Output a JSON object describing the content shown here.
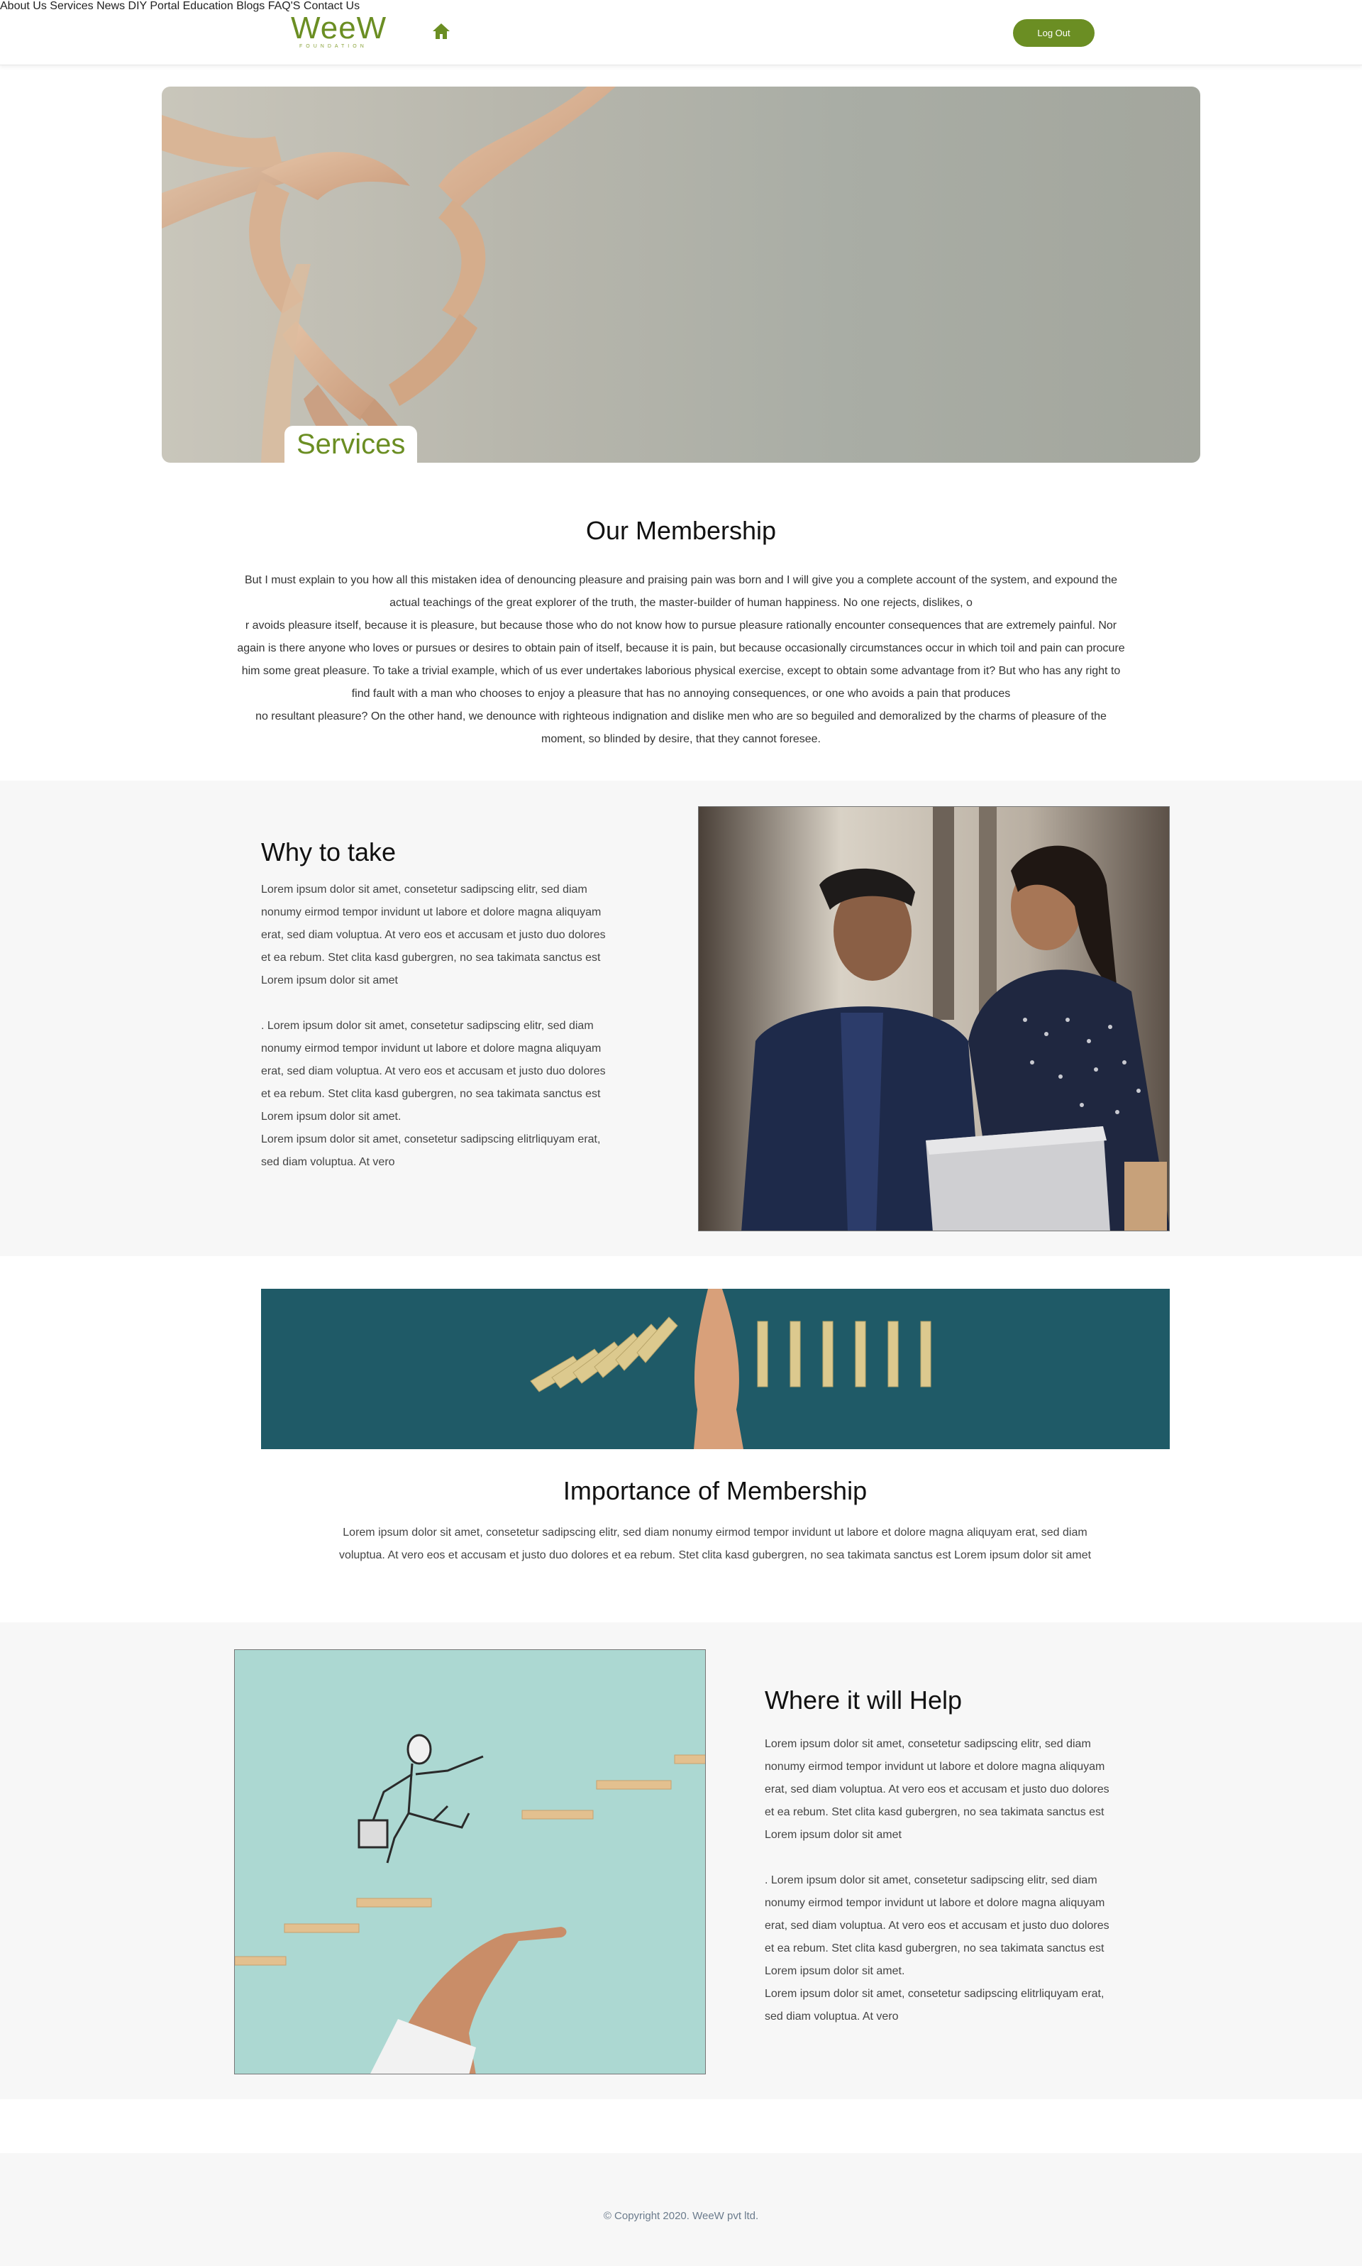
{
  "brand": {
    "name": "WeeW",
    "tagline": "FOUNDATION",
    "accent_color": "#6b8e23"
  },
  "nav": {
    "home_icon": "home-icon",
    "items": [
      {
        "label": "About Us"
      },
      {
        "label": "Services"
      },
      {
        "label": "News"
      },
      {
        "label": "DIY Portal"
      },
      {
        "label": "Education"
      },
      {
        "label": "Blogs"
      },
      {
        "label": "FAQ'S"
      },
      {
        "label": "Contact Us"
      }
    ],
    "logout_label": "Log Out"
  },
  "hero": {
    "title": "Services",
    "image": "hands-forming-heart-photo"
  },
  "membership": {
    "title": "Our Membership",
    "lines": [
      "But I must explain to you how all this mistaken idea of denouncing pleasure and praising pain was born and I will give you a complete account of the system, and expound the",
      "actual teachings of the great explorer of the truth, the master-builder of human happiness. No one rejects, dislikes, o",
      "r avoids pleasure itself, because it is pleasure, but because those who do not know how to pursue pleasure rationally encounter consequences that are extremely painful. Nor",
      "again is there anyone who loves or pursues or desires to obtain pain of itself, because it is pain, but because occasionally circumstances occur in which toil and pain can procure",
      "him some great pleasure. To take a trivial example, which of us ever undertakes laborious physical exercise, except to obtain some advantage from it? But who has any right to",
      "find fault with a man who chooses to enjoy a pleasure that has no annoying consequences, or one who avoids a pain that produces",
      "no resultant pleasure? On the other hand, we denounce with righteous indignation and dislike men who are so beguiled and demoralized by the charms of pleasure of the",
      "moment, so blinded by desire, that they cannot foresee."
    ]
  },
  "why": {
    "title": "Why to take",
    "paragraph1": "Lorem ipsum dolor sit amet, consetetur sadipscing elitr, sed diam nonumy eirmod tempor invidunt ut labore et dolore magna aliquyam erat, sed diam voluptua. At vero eos et accusam et justo duo dolores et ea rebum. Stet clita kasd gubergren, no sea takimata sanctus est Lorem ipsum dolor sit amet",
    "paragraph2": ". Lorem ipsum dolor sit amet, consetetur sadipscing elitr, sed diam nonumy eirmod tempor invidunt ut labore et dolore magna aliquyam erat, sed diam voluptua. At vero eos et accusam et justo duo dolores et ea rebum. Stet clita kasd gubergren, no sea takimata sanctus est Lorem ipsum dolor sit amet.",
    "paragraph3": "Lorem ipsum dolor sit amet, consetetur sadipscing elitrliquyam erat, sed diam voluptua. At vero",
    "image": "colleagues-at-laptop-photo"
  },
  "importance": {
    "banner_image": "hand-stopping-dominoes-photo",
    "title": "Importance of Membership",
    "text": "Lorem ipsum dolor sit amet, consetetur sadipscing elitr, sed diam nonumy eirmod tempor invidunt ut labore et dolore magna aliquyam erat, sed diam voluptua. At vero eos et accusam et justo duo dolores et ea rebum. Stet clita kasd gubergren, no sea takimata sanctus est Lorem ipsum dolor sit amet"
  },
  "where": {
    "title": "Where it will Help",
    "paragraph1": "Lorem ipsum dolor sit amet, consetetur sadipscing elitr, sed diam nonumy eirmod tempor invidunt ut labore et dolore magna aliquyam erat, sed diam voluptua. At vero eos et accusam et justo duo dolores et ea rebum. Stet clita kasd gubergren, no sea takimata sanctus est Lorem ipsum dolor sit amet",
    "paragraph2": ". Lorem ipsum dolor sit amet, consetetur sadipscing elitr, sed diam nonumy eirmod tempor invidunt ut labore et dolore magna aliquyam erat, sed diam voluptua. At vero eos et accusam et justo duo dolores et ea rebum. Stet clita kasd gubergren, no sea takimata sanctus est Lorem ipsum dolor sit amet.",
    "paragraph3": "Lorem ipsum dolor sit amet, consetetur sadipscing elitrliquyam erat, sed diam voluptua. At vero",
    "image": "man-climbing-steps-photo"
  },
  "footer": {
    "copyright": "© Copyright 2020. WeeW pvt ltd."
  }
}
